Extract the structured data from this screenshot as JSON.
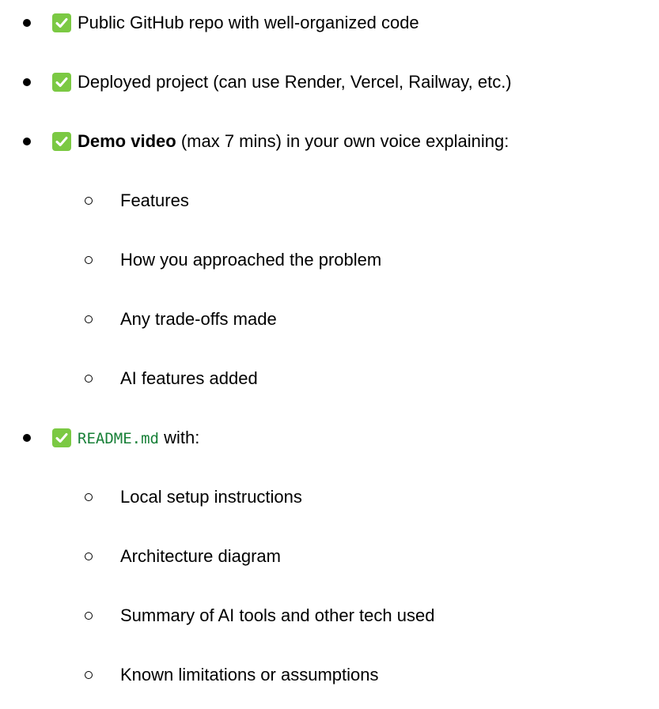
{
  "items": [
    {
      "text": "Public GitHub repo with well-organized code"
    },
    {
      "text": "Deployed project (can use Render, Vercel, Railway, etc.)"
    },
    {
      "bold": "Demo video",
      "rest": " (max 7 mins) in your own voice explaining:",
      "subitems": [
        "Features",
        "How you approached the problem",
        "Any trade-offs made",
        "AI features added"
      ]
    },
    {
      "code": "README.md",
      "rest": " with:",
      "subitems": [
        "Local setup instructions",
        "Architecture diagram",
        "Summary of AI tools and other tech used",
        "Known limitations or assumptions"
      ]
    }
  ],
  "colors": {
    "check_bg": "#7bc943",
    "code_text": "#188038"
  },
  "icons": {
    "check": "check-mark-button-icon"
  }
}
